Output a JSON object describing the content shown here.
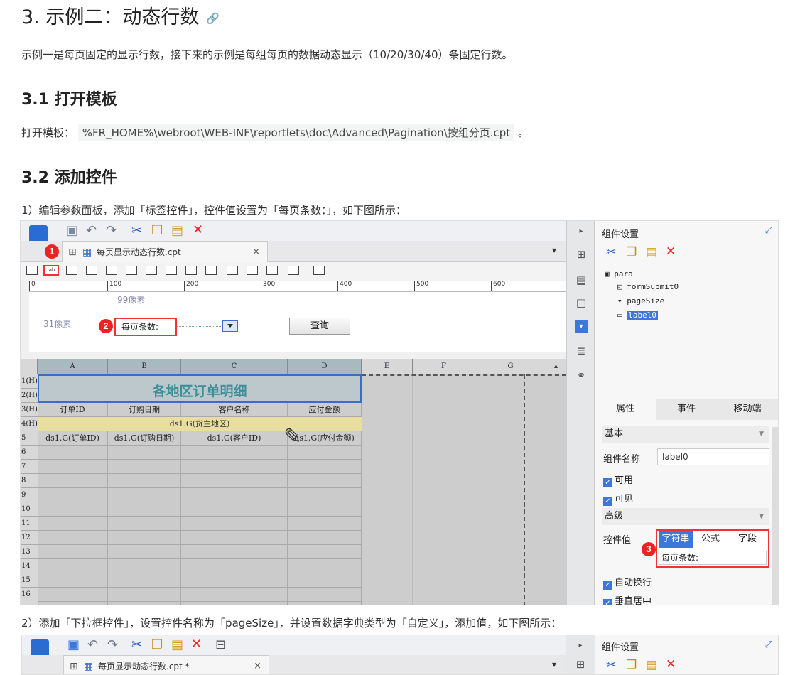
{
  "heading": "3. 示例二：动态行数",
  "intro": "示例一是每页固定的显示行数，接下来的示例是每组每页的数据动态显示（10/20/30/40）条固定行数。",
  "s31": {
    "title": "3.1 打开模板",
    "label": "打开模板：",
    "path": "%FR_HOME%\\webroot\\WEB-INF\\reportlets\\doc\\Advanced\\Pagination\\按组分页.cpt",
    "end": "。"
  },
  "s32": {
    "title": "3.2 添加控件",
    "step1": "1）编辑参数面板，添加「标签控件」，控件值设置为「每页条数：」，如下图所示：",
    "step2": "2）添加「下拉框控件」，设置控件名称为「pageSize」，并设置数据字典类型为「自定义」，添加值，如下图所示："
  },
  "shot1": {
    "tab_title": "每页显示动态行数.cpt",
    "lab_text": "lab",
    "ruler_ticks": [
      "0",
      "100",
      "200",
      "300",
      "400",
      "500",
      "600"
    ],
    "px_99": "99像素",
    "px_31": "31像素",
    "badges": [
      "1",
      "2",
      "3"
    ],
    "label_value": "每页条数:",
    "query_button": "查询",
    "columns": [
      "A",
      "B",
      "C",
      "D",
      "E",
      "F",
      "G"
    ],
    "row_headers": [
      "1(H)",
      "2(H)",
      "3(H)",
      "4(H)",
      "5",
      "6",
      "7",
      "8",
      "9",
      "10",
      "11",
      "12",
      "13",
      "14",
      "15",
      "16"
    ],
    "report_title": "各地区订单明细",
    "headers": [
      "订单ID",
      "订购日期",
      "客户名称",
      "应付金额"
    ],
    "group_row": "ds1.G(货主地区)",
    "data_row": [
      "ds1.G(订单ID)",
      "ds1.G(订购日期)",
      "ds1.G(客户ID)",
      "ds1.G(应付金额)"
    ],
    "panel": {
      "title": "组件设置",
      "tree": [
        "para",
        "formSubmit0",
        "pageSize",
        "label0"
      ],
      "tabs": [
        "属性",
        "事件",
        "移动端"
      ],
      "basic": "基本",
      "name_label": "组件名称",
      "name_value": "label0",
      "enabled": "可用",
      "visible": "可见",
      "advanced": "高级",
      "value_label": "控件值",
      "value_types": [
        "字符串",
        "公式",
        "字段"
      ],
      "value_text": "每页条数:",
      "wrap": "自动换行",
      "vcenter": "垂直居中"
    }
  },
  "shot2": {
    "tab_title": "每页显示动态行数.cpt *",
    "panel_title": "组件设置"
  },
  "colors": {
    "accent": "#3c78d8",
    "badge": "#e22222"
  }
}
